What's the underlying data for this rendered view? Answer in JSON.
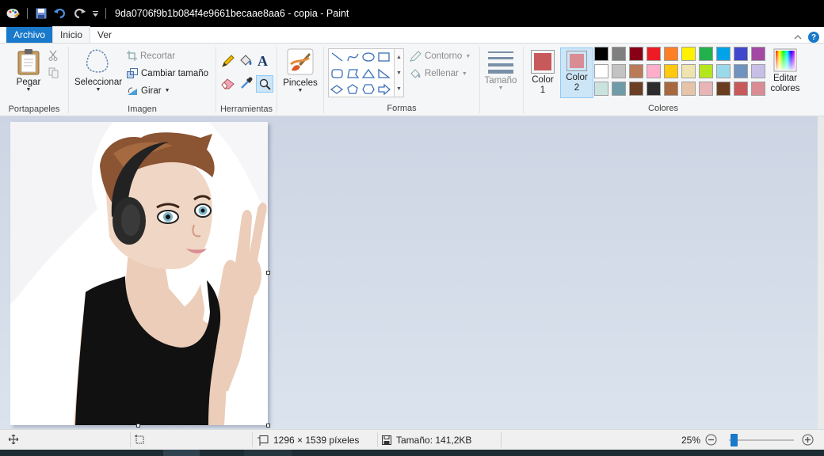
{
  "window": {
    "title": "9da0706f9b1b084f4e9661becaae8aa6 - copia - Paint"
  },
  "tabs": [
    {
      "label": "Archivo"
    },
    {
      "label": "Inicio"
    },
    {
      "label": "Ver"
    }
  ],
  "ribbon": {
    "clipboard": {
      "paste": "Pegar",
      "group": "Portapapeles"
    },
    "image": {
      "select": "Seleccionar",
      "crop": "Recortar",
      "resize": "Cambiar tamaño",
      "rotate": "Girar",
      "group": "Imagen"
    },
    "tools": {
      "group": "Herramientas"
    },
    "brushes": {
      "label": "Pinceles"
    },
    "shapes": {
      "outline": "Contorno",
      "fill": "Rellenar",
      "group": "Formas"
    },
    "size": {
      "label": "Tamaño"
    },
    "colors": {
      "color1_label_a": "Color",
      "color1_label_b": "1",
      "color2_label_a": "Color",
      "color2_label_b": "2",
      "color1": "#c8595a",
      "color2": "#d98c94",
      "edit_a": "Editar",
      "edit_b": "colores",
      "group": "Colores",
      "palette": [
        [
          "#000000",
          "#7f7f7f",
          "#880015",
          "#ed1c24",
          "#ff7f27",
          "#fff200",
          "#22b14c",
          "#00a2e8",
          "#3f48cc",
          "#a349a4"
        ],
        [
          "#ffffff",
          "#c3c3c3",
          "#b97a57",
          "#ffaec9",
          "#ffc90e",
          "#efe4b0",
          "#b5e61d",
          "#99d9ea",
          "#7092be",
          "#c8bfe7"
        ],
        [
          "#cbe3df",
          "#6f9aa8",
          "#6b3f24",
          "#2c2c2c",
          "#a8683e",
          "#e6c4a7",
          "#e7b5b5",
          "#6b3d1f",
          "#c8595a",
          "#d98c94"
        ]
      ]
    }
  },
  "status": {
    "dimensions": "1296 × 1539 píxeles",
    "size": "Tamaño: 141,2KB",
    "zoom": "25%"
  }
}
